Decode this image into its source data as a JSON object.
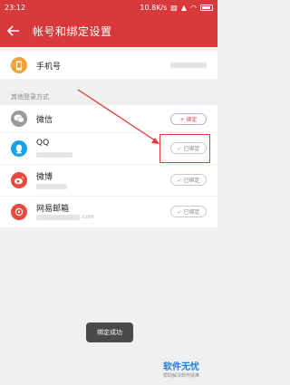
{
  "statusbar": {
    "time": "23:12",
    "network": "10.8K/s"
  },
  "titlebar": {
    "title": "帐号和绑定设置"
  },
  "phone": {
    "label": "手机号"
  },
  "section": {
    "other_login": "其他登录方式"
  },
  "accounts": [
    {
      "name": "微信",
      "button": "+ 绑定",
      "state": "unbound",
      "icon": "wechat-icon",
      "color": "#9b9b9b"
    },
    {
      "name": "QQ",
      "button": "✓ 已绑定",
      "state": "bound",
      "icon": "qq-icon",
      "color": "#1aa0e6"
    },
    {
      "name": "微博",
      "button": "✓ 已绑定",
      "state": "bound",
      "icon": "weibo-icon",
      "color": "#e84a40"
    },
    {
      "name": "网易邮箱",
      "button": "✓ 已绑定",
      "state": "bound",
      "icon": "netease-mail-icon",
      "color": "#e84a40",
      "sub": ".com"
    }
  ],
  "toast": {
    "text": "绑定成功"
  },
  "watermark": {
    "title": "软件无忧",
    "sub": "帮助解决软件疑难"
  },
  "colors": {
    "brand": "#d8393b",
    "phone_icon": "#f2a33a"
  }
}
